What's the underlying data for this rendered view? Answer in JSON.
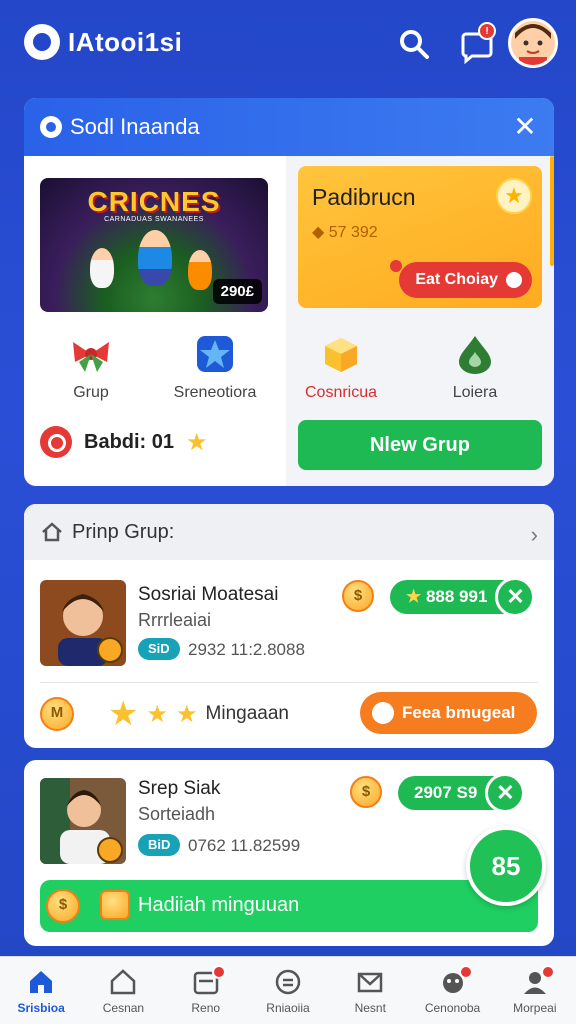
{
  "app": {
    "title": "IAtooi1si"
  },
  "header": {
    "notification_count": "!"
  },
  "card1": {
    "title": "Sodl Inaanda",
    "game": {
      "title": "CRICNES",
      "subtitle": "CARNADUAS SWANANEES",
      "price": "290£"
    },
    "categories": [
      {
        "label": "Grup",
        "icon": "bow-icon"
      },
      {
        "label": "Sreneotiora",
        "icon": "star-badge-icon"
      },
      {
        "label": "Cosnricua",
        "icon": "gold-box-icon"
      },
      {
        "label": "Loiera",
        "icon": "green-drop-icon"
      }
    ],
    "badge_row": {
      "text": "Babdi: 01"
    },
    "promo": {
      "title": "Padibrucn",
      "coins": "57 392",
      "button": "Eat Choiay"
    },
    "new_group_button": "Nlew Grup"
  },
  "card2": {
    "title": "Prinp Grup:",
    "user": {
      "name": "Sosriai Moatesai",
      "subtitle": "Rrrrleaiai",
      "tag": "SiD",
      "number": "2932 11:2.8088",
      "pill_value": "888 991"
    },
    "bottom": {
      "label": "Mingaaan",
      "button": "Feea bmugeal",
      "coin_label": "M"
    }
  },
  "card3": {
    "user": {
      "name": "Srep Siak",
      "subtitle": "Sorteiadh",
      "tag": "BiD",
      "number": "0762 11.82599",
      "pill_value": "2907 S9"
    },
    "bar_label": "Hadiiah minguuan",
    "bubble_value": "85"
  },
  "tabs": [
    {
      "label": "Srisbioa",
      "icon": "home-icon",
      "active": true,
      "badge": false
    },
    {
      "label": "Cesnan",
      "icon": "house-outline-icon",
      "active": false,
      "badge": false
    },
    {
      "label": "Reno",
      "icon": "card-icon",
      "active": false,
      "badge": true
    },
    {
      "label": "Rniaoiia",
      "icon": "equals-circle-icon",
      "active": false,
      "badge": false
    },
    {
      "label": "Nesnt",
      "icon": "mail-icon",
      "active": false,
      "badge": false
    },
    {
      "label": "Cenonoba",
      "icon": "game-pad-icon",
      "active": false,
      "badge": true
    },
    {
      "label": "Morpeai",
      "icon": "profile-icon",
      "active": false,
      "badge": true
    }
  ],
  "colors": {
    "primary": "#2447c9",
    "green": "#1fb954",
    "orange": "#f57c1f",
    "promo": "#ffb92a",
    "red": "#e53935"
  }
}
